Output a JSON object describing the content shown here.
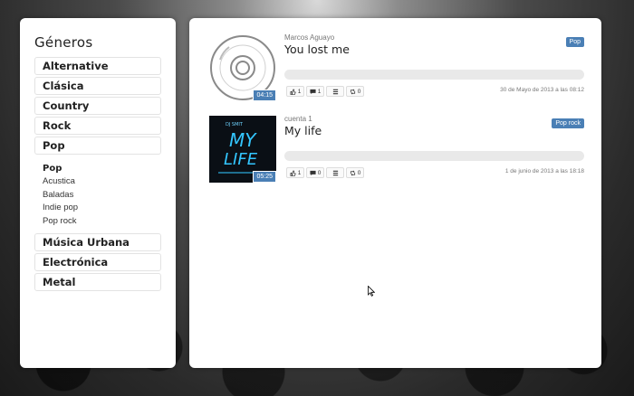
{
  "sidebar": {
    "heading": "Géneros",
    "genres_top": [
      {
        "label": "Alternative"
      },
      {
        "label": "Clásica"
      },
      {
        "label": "Country"
      },
      {
        "label": "Rock"
      },
      {
        "label": "Pop"
      }
    ],
    "submenu": {
      "heading": "Pop",
      "items": [
        "Acustica",
        "Baladas",
        "Indie pop",
        "Pop rock"
      ]
    },
    "genres_bottom": [
      {
        "label": "Música Urbana"
      },
      {
        "label": "Electrónica"
      },
      {
        "label": "Metal"
      }
    ]
  },
  "tracks": [
    {
      "author": "Marcos Aguayo",
      "title": "You lost me",
      "duration": "04:15",
      "genre_badge": "Pop",
      "cover_icon": "cd-disc-icon",
      "likes": "1",
      "comments": "1",
      "reposts": "0",
      "date": "30 de Mayo de 2013 a las 08:12",
      "progress": 0
    },
    {
      "author": "cuenta 1",
      "title": "My life",
      "duration": "05:25",
      "genre_badge": "Pop rock",
      "cover_text_small": "DJ SMIT",
      "cover_text_big_1": "MY",
      "cover_text_big_2": "LIFE",
      "likes": "1",
      "comments": "0",
      "reposts": "0",
      "date": "1 de junio de 2013 a las 18:18",
      "progress": 0
    }
  ],
  "colors": {
    "accent": "#4a7fb5",
    "panel": "#ffffff",
    "progress_track": "#e9e9e9"
  }
}
